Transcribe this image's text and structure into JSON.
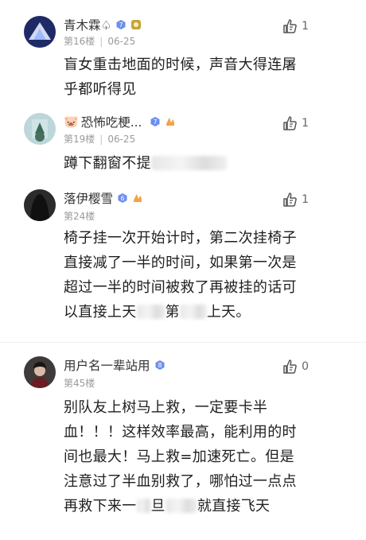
{
  "comments": [
    {
      "username": "青木霖♤",
      "floor": "第16楼",
      "date": "06-25",
      "likes": "1",
      "text_lines": [
        "盲女重击地面的时候，声音大得连屠",
        "乎都听得见"
      ]
    },
    {
      "username": "恐怖吃梗...",
      "floor": "第19楼",
      "date": "06-25",
      "likes": "1",
      "text_visible": "蹲下翻窗不提"
    },
    {
      "username": "落伊樱雪",
      "floor": "第24楼",
      "date": "",
      "likes": "1",
      "text_lines": [
        "椅子挂一次开始计时，第二次挂椅子",
        "直接减了一半的时间，如果第一次是",
        "超过一半的时间被救了再被挂的话可"
      ],
      "text_last_a": "以直接上天",
      "text_last_b": "第",
      "text_last_c": "上天。"
    },
    {
      "username": "用户名一辈站用",
      "floor": "第45楼",
      "date": "",
      "likes": "0",
      "text_lines": [
        "别队友上树马上救，一定要卡半",
        "血！！！这样效率最高，能利用的时",
        "间也最大！马上救=加速死亡。但是",
        "注意过了半血别救了，哪怕过一点点"
      ],
      "text_last_a": "再救下来一",
      "text_last_b": "旦",
      "text_last_c": "就直接飞天"
    }
  ],
  "colors": {
    "vip_blue": "#6d8ef0",
    "fire": "#f3a24a",
    "level_gold": "#c7a33a"
  }
}
